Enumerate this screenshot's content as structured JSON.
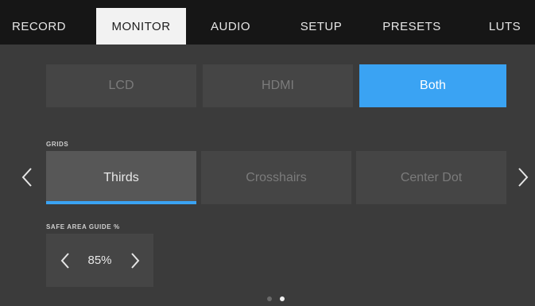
{
  "tabs": [
    {
      "label": "RECORD",
      "active": false
    },
    {
      "label": "MONITOR",
      "active": true
    },
    {
      "label": "AUDIO",
      "active": false
    },
    {
      "label": "SETUP",
      "active": false
    },
    {
      "label": "PRESETS",
      "active": false
    },
    {
      "label": "LUTS",
      "active": false
    }
  ],
  "outputs": {
    "options": [
      "LCD",
      "HDMI",
      "Both"
    ],
    "selected": "Both"
  },
  "grids": {
    "label": "GRIDS",
    "options": [
      "Thirds",
      "Crosshairs",
      "Center Dot"
    ],
    "selected": "Thirds"
  },
  "safe_area": {
    "label": "SAFE AREA GUIDE %",
    "value": "85%"
  },
  "pagination": {
    "pages": 2,
    "current": 2
  },
  "icons": {
    "prev_page": "chevron-left-icon",
    "next_page": "chevron-right-icon",
    "decrease": "chevron-left-icon",
    "increase": "chevron-right-icon"
  },
  "colors": {
    "accent": "#3aa3f3",
    "background": "#3b3b3b",
    "tabbar": "#161616",
    "button": "#454545",
    "button_selected_neutral": "#575757"
  }
}
